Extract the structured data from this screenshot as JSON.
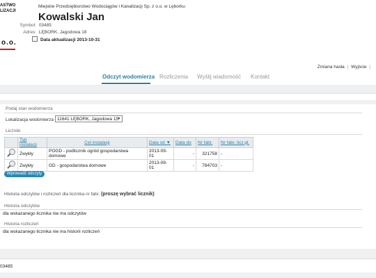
{
  "logo": {
    "line1": "ASTWO",
    "line2": "LIZACJI",
    "mark": "o.o."
  },
  "header": {
    "company": "Miejskie Przedsiębiorstwo Wodociągów i Kanalizacji Sp. z o.o. w Lęborku",
    "name": "Kowalski Jan",
    "symbol_label": "Symbol:",
    "symbol_value": "03485",
    "address_label": "Adres:",
    "address_value": "LĘBORK, Jagodowa 18",
    "update_label": "Data aktualizacji 2013-10-31"
  },
  "toplinks": {
    "change_password": "Zmiana hasła",
    "separator": "|",
    "logout": "Wyjście",
    "trailing": "|"
  },
  "tabs": [
    {
      "label": "Odczyt wodomierza",
      "active": true
    },
    {
      "label": "Rozliczenia",
      "active": false
    },
    {
      "label": "Wyślij wiadomość",
      "active": false
    },
    {
      "label": "Kontakt",
      "active": false
    }
  ],
  "main": {
    "section_title": "Podaj stan wodomierza",
    "location_label": "Lokalizacja wodomierza",
    "location_value": "11641 LĘBORK, Jagodowa 18",
    "meters_title": "Liczniki",
    "table": {
      "headers": [
        "Typ instalacji",
        "Cel instalacji",
        "Data od ▼",
        "Data do",
        "Nr fabr.",
        "Nr fabr. licz.gl."
      ],
      "rows": [
        [
          "Zwykły",
          "POGD - podlicznik ogród gospodarstwa domowe",
          "2013-09-01",
          "-",
          "321758",
          "-"
        ],
        [
          "Zwykły",
          "GD - gospodarstwa domowe",
          "2013-09-01",
          "-",
          "784703",
          "-"
        ]
      ]
    },
    "button_enter": "Wprowadź odczyty",
    "history_title": "Historia odczytów i rozliczeń dla licznika nr fabr.",
    "history_hint": "(proszę wybrać licznik)",
    "reads_label": "Historia odczytów",
    "reads_msg": "dla wskazanego licznika nie ma odczytów",
    "settlements_label": "Historia rozliczeń",
    "settlements_msg": "dla wskazanego licznika nie ma historii rozliczeń"
  },
  "footer": {
    "text": "03485"
  },
  "colors": {
    "accent": "#2a7fa8",
    "logo_red": "#d01818"
  }
}
